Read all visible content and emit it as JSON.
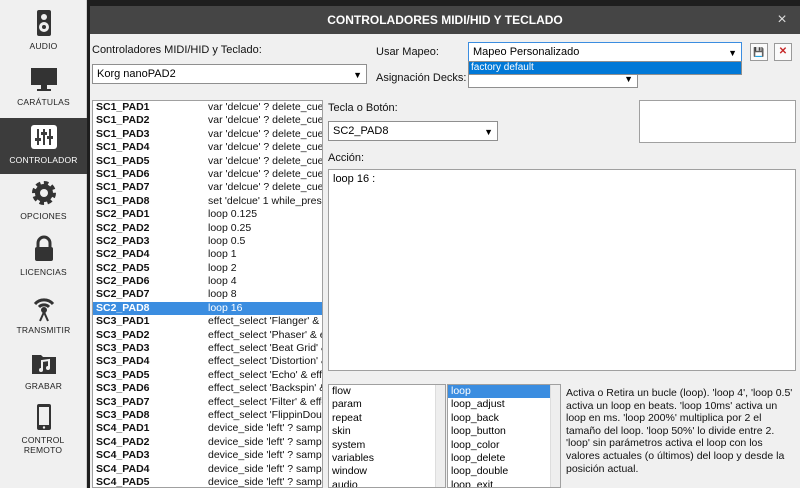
{
  "sidebar": {
    "items": [
      {
        "label": "AUDIO",
        "icon": "speaker-icon"
      },
      {
        "label": "CARÁTULAS",
        "icon": "monitor-icon"
      },
      {
        "label": "CONTROLADOR",
        "icon": "sliders-icon"
      },
      {
        "label": "OPCIONES",
        "icon": "gear-icon"
      },
      {
        "label": "LICENCIAS",
        "icon": "lock-icon"
      },
      {
        "label": "TRANSMITIR",
        "icon": "broadcast-icon"
      },
      {
        "label": "GRABAR",
        "icon": "music-folder-icon"
      },
      {
        "label": "CONTROL REMOTO",
        "icon": "phone-icon"
      }
    ],
    "active_index": 2
  },
  "window": {
    "title": "CONTROLADORES MIDI/HID Y TECLADO",
    "close_glyph": "×"
  },
  "device": {
    "label": "Controladores MIDI/HID y Teclado:",
    "value": "Korg nanoPAD2"
  },
  "mapping": {
    "label": "Usar Mapeo:",
    "value": "Mapeo Personalizado",
    "dropdown_option": "factory default",
    "save_glyph": "💾",
    "delete_glyph": "✕"
  },
  "decks": {
    "label": "Asignación Decks:",
    "value": ""
  },
  "key": {
    "label": "Tecla o Botón:",
    "value": "SC2_PAD8"
  },
  "action": {
    "label": "Acción:",
    "value": "loop 16 :"
  },
  "mappings": [
    {
      "key": "SC1_PAD1",
      "action": "var 'delcue' ? delete_cue"
    },
    {
      "key": "SC1_PAD2",
      "action": "var 'delcue' ? delete_cue"
    },
    {
      "key": "SC1_PAD3",
      "action": "var 'delcue' ? delete_cue"
    },
    {
      "key": "SC1_PAD4",
      "action": "var 'delcue' ? delete_cue"
    },
    {
      "key": "SC1_PAD5",
      "action": "var 'delcue' ? delete_cue"
    },
    {
      "key": "SC1_PAD6",
      "action": "var 'delcue' ? delete_cue"
    },
    {
      "key": "SC1_PAD7",
      "action": "var 'delcue' ? delete_cue"
    },
    {
      "key": "SC1_PAD8",
      "action": "set 'delcue' 1 while_pres"
    },
    {
      "key": "SC2_PAD1",
      "action": "loop 0.125"
    },
    {
      "key": "SC2_PAD2",
      "action": "loop 0.25"
    },
    {
      "key": "SC2_PAD3",
      "action": "loop 0.5"
    },
    {
      "key": "SC2_PAD4",
      "action": "loop 1"
    },
    {
      "key": "SC2_PAD5",
      "action": "loop 2"
    },
    {
      "key": "SC2_PAD6",
      "action": "loop 4"
    },
    {
      "key": "SC2_PAD7",
      "action": "loop 8"
    },
    {
      "key": "SC2_PAD8",
      "action": "loop 16"
    },
    {
      "key": "SC3_PAD1",
      "action": "effect_select 'Flanger' & e"
    },
    {
      "key": "SC3_PAD2",
      "action": "effect_select 'Phaser' & e"
    },
    {
      "key": "SC3_PAD3",
      "action": "effect_select 'Beat Grid' &"
    },
    {
      "key": "SC3_PAD4",
      "action": "effect_select 'Distortion' &"
    },
    {
      "key": "SC3_PAD5",
      "action": "effect_select 'Echo' & effe"
    },
    {
      "key": "SC3_PAD6",
      "action": "effect_select 'Backspin' &"
    },
    {
      "key": "SC3_PAD7",
      "action": "effect_select 'Filter' & effe"
    },
    {
      "key": "SC3_PAD8",
      "action": "effect_select 'FlippinDou"
    },
    {
      "key": "SC4_PAD1",
      "action": "device_side 'left' ? samp"
    },
    {
      "key": "SC4_PAD2",
      "action": "device_side 'left' ? samp"
    },
    {
      "key": "SC4_PAD3",
      "action": "device_side 'left' ? samp"
    },
    {
      "key": "SC4_PAD4",
      "action": "device_side 'left' ? samp"
    },
    {
      "key": "SC4_PAD5",
      "action": "device_side 'left' ? samp"
    }
  ],
  "selected_mapping": 15,
  "categories": [
    "flow",
    "param",
    "repeat",
    "skin",
    "system",
    "variables",
    "window",
    "audio"
  ],
  "verbs": [
    "loop",
    "loop_adjust",
    "loop_back",
    "loop_button",
    "loop_color",
    "loop_delete",
    "loop_double",
    "loop_exit"
  ],
  "selected_verb": 0,
  "help": "Activa o Retira un bucle (loop). 'loop 4', 'loop 0.5' activa un loop en beats. 'loop 10ms' activa un loop en ms. 'loop 200%' multiplica por 2 el tamaño del loop. 'loop 50%' lo divide entre 2. 'loop' sin parámetros activa el loop con los valores actuales (o últimos) del loop y desde la posición actual.",
  "colors": {
    "accent": "#3b8de0",
    "titlebar": "#454545",
    "sidebar_active": "#3c3c3c"
  }
}
